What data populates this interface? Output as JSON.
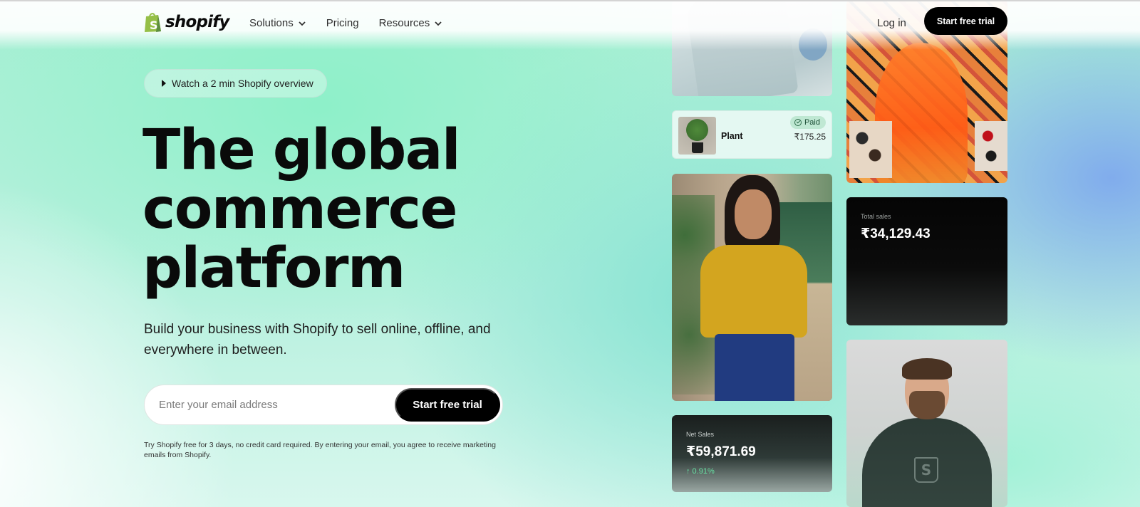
{
  "nav": {
    "brand": "shopify",
    "links": [
      {
        "label": "Solutions",
        "has_dropdown": true
      },
      {
        "label": "Pricing",
        "has_dropdown": false
      },
      {
        "label": "Resources",
        "has_dropdown": true
      }
    ],
    "login": "Log in",
    "cta": "Start free trial"
  },
  "hero": {
    "watch_label": "Watch a 2 min Shopify overview",
    "headline_lines": [
      "The global",
      "commerce",
      "platform"
    ],
    "subheading": "Build your business with Shopify to sell online, offline, and everywhere in between.",
    "email_placeholder": "Enter your email address",
    "email_value": "",
    "cta": "Start free trial",
    "disclaimer": "Try Shopify free for 3 days, no credit card required. By entering your email, you agree to receive marketing emails from Shopify."
  },
  "cards": {
    "order": {
      "status": "Paid",
      "product": "Plant",
      "price": "₹175.25"
    },
    "net_sales": {
      "label": "Net Sales",
      "value": "₹59,871.69",
      "change": "↑ 0.91%"
    },
    "total_sales": {
      "label": "Total sales",
      "value": "₹34,129.43"
    }
  },
  "colors": {
    "brand_green": "#95bf47",
    "brand_dark_green": "#5e8e3e",
    "cta_black": "#000000",
    "positive_change": "#68e3a4",
    "paid_badge": "#bfe8d3"
  },
  "icons": {
    "logo": "shopify-bag-icon",
    "dropdown": "chevron-down-icon",
    "play": "play-icon",
    "paid": "check-circle-icon"
  }
}
